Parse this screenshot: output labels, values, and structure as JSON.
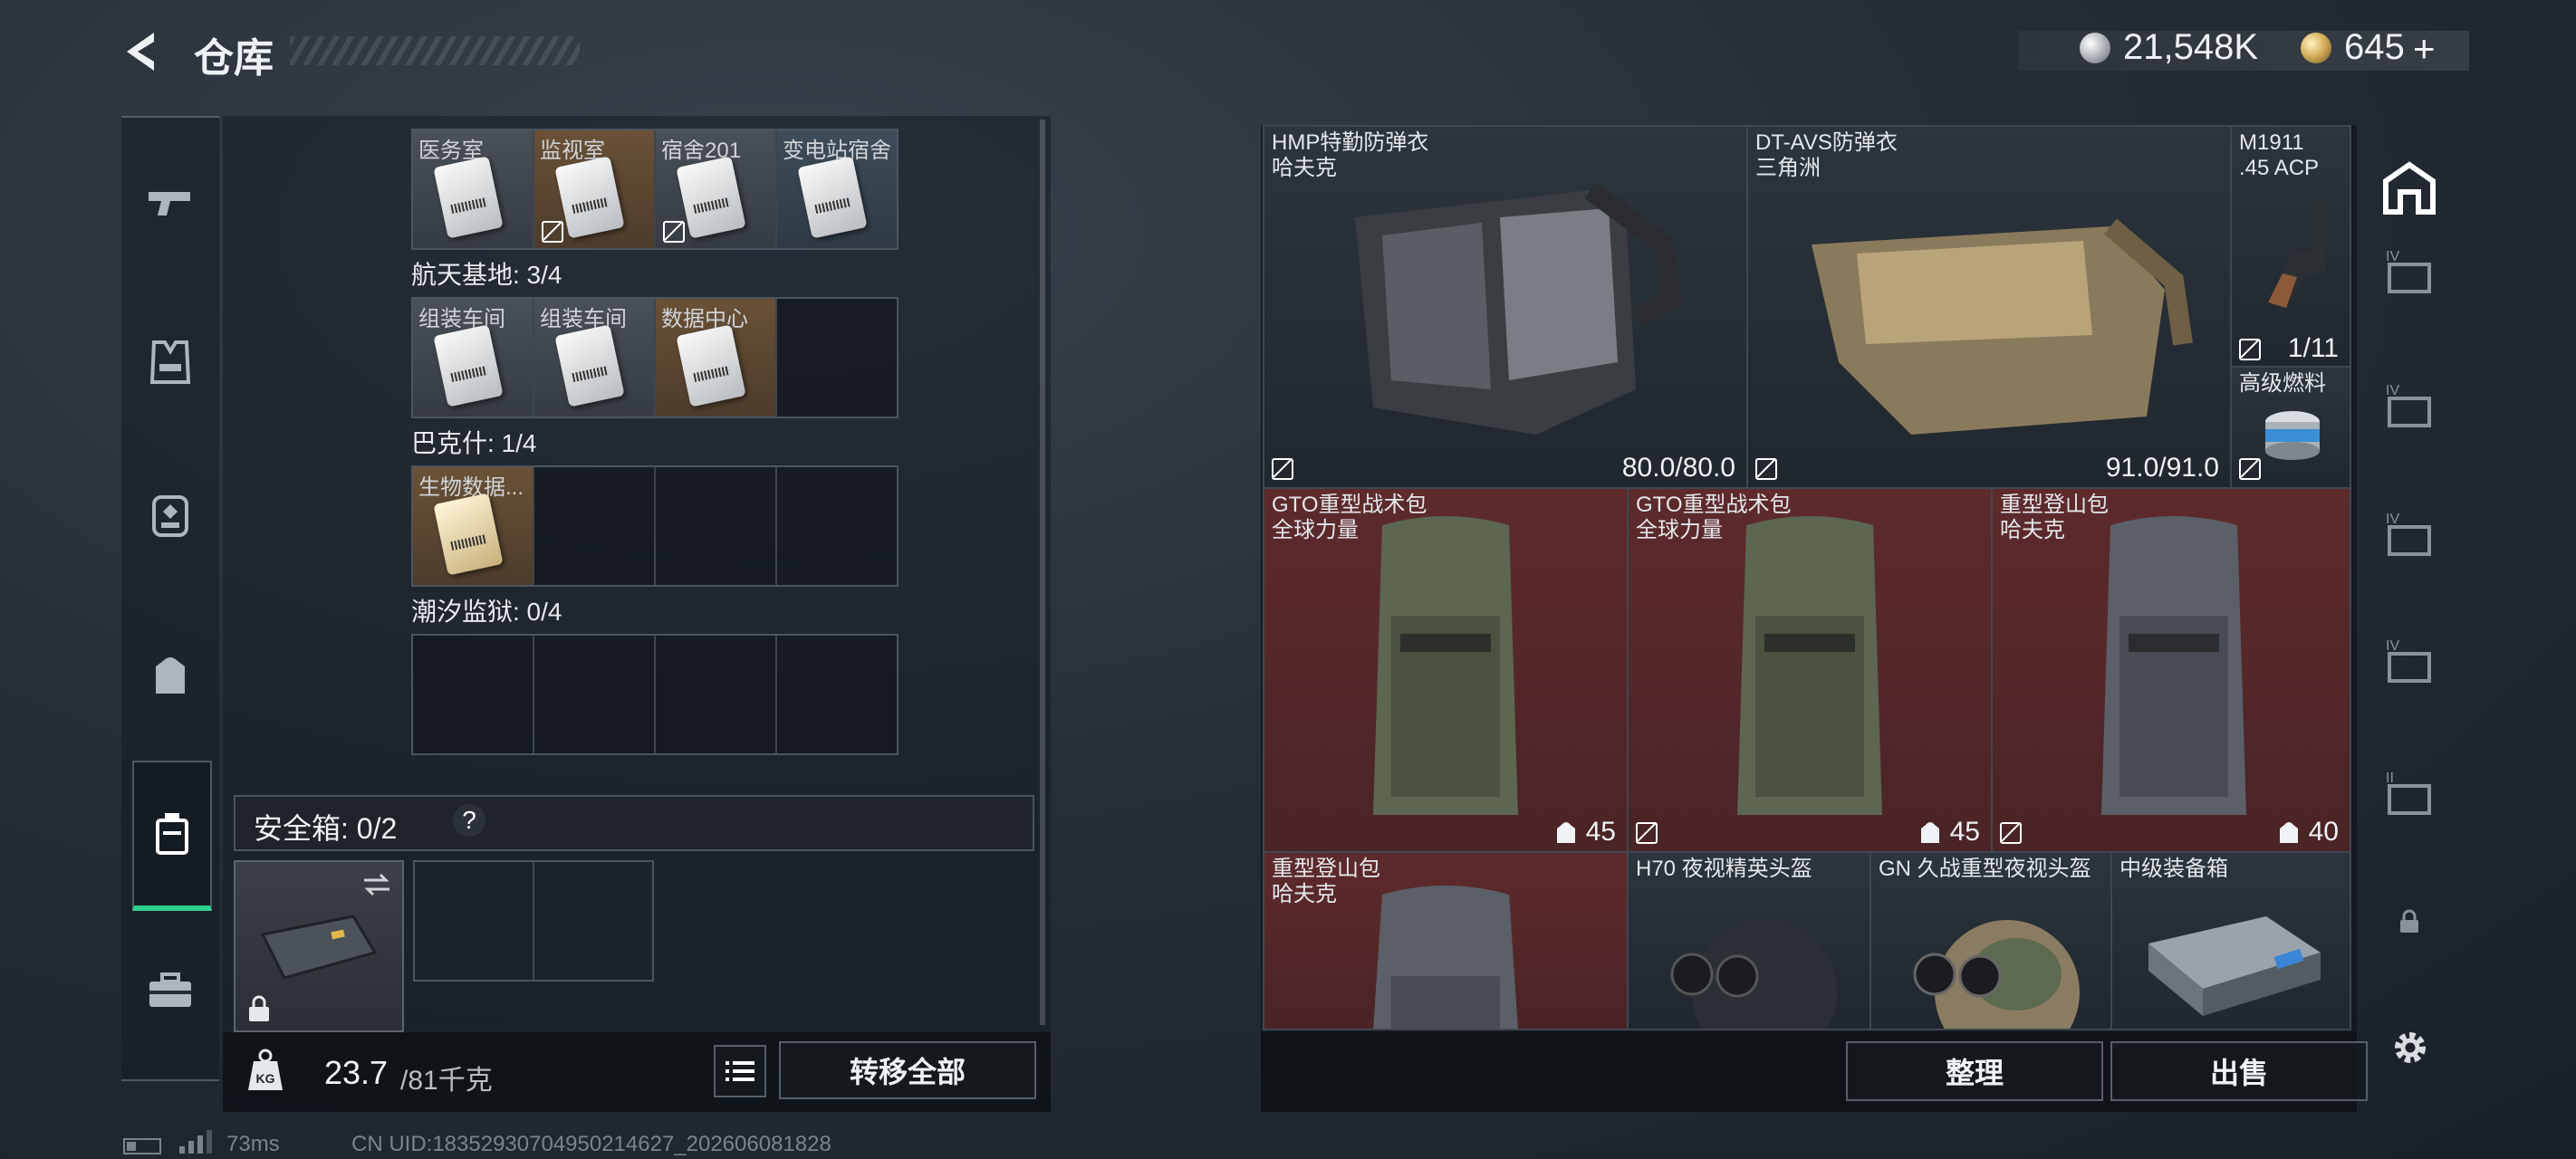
{
  "header": {
    "title": "仓库",
    "silver": "21,548K",
    "gold": "645",
    "gold_add": "+"
  },
  "left_rail": {
    "items": [
      "pistol-icon",
      "vest-icon",
      "armor-icon",
      "backpack-icon",
      "case-icon",
      "toolbox-icon"
    ]
  },
  "keycards": {
    "row1": [
      "医务室",
      "监视室",
      "宿舍201",
      "变电站宿舍"
    ],
    "base1_label": "航天基地: 3/4",
    "row2": [
      "组装车间",
      "组装车间",
      "数据中心",
      ""
    ],
    "base2_label": "巴克什: 1/4",
    "row3": [
      "生物数据...",
      "",
      "",
      ""
    ],
    "base3_label": "潮汐监狱: 0/4"
  },
  "safe": {
    "label": "安全箱: 0/2",
    "help": "?"
  },
  "weight": {
    "current": "23.7",
    "max": "/81千克",
    "transfer_all": "转移全部"
  },
  "items": {
    "hmp": {
      "name": "HMP特勤防弹衣",
      "maker": "哈夫克",
      "durability": "80.0/80.0"
    },
    "dtavs": {
      "name": "DT-AVS防弹衣",
      "maker": "三角洲",
      "durability": "91.0/91.0"
    },
    "m1911": {
      "name": "M1911",
      "sub": ".45 ACP",
      "ammo": "1/11"
    },
    "fuel": {
      "name": "高级燃料"
    },
    "gto1": {
      "name": "GTO重型战术包",
      "maker": "全球力量",
      "cap": "45"
    },
    "gto2": {
      "name": "GTO重型战术包",
      "maker": "全球力量",
      "cap": "45"
    },
    "mtn1": {
      "name": "重型登山包",
      "maker": "哈夫克",
      "cap": "40"
    },
    "mtn2": {
      "name": "重型登山包",
      "maker": "哈夫克"
    },
    "h70": {
      "name": "H70 夜视精英头盔"
    },
    "gn": {
      "name": "GN 久战重型夜视头盔"
    },
    "box": {
      "name": "中级装备箱"
    }
  },
  "actions": {
    "sort": "整理",
    "sell": "出售"
  },
  "footer": {
    "ping": "73ms",
    "uid": "CN UID:18352930704950214627_202606081828"
  }
}
